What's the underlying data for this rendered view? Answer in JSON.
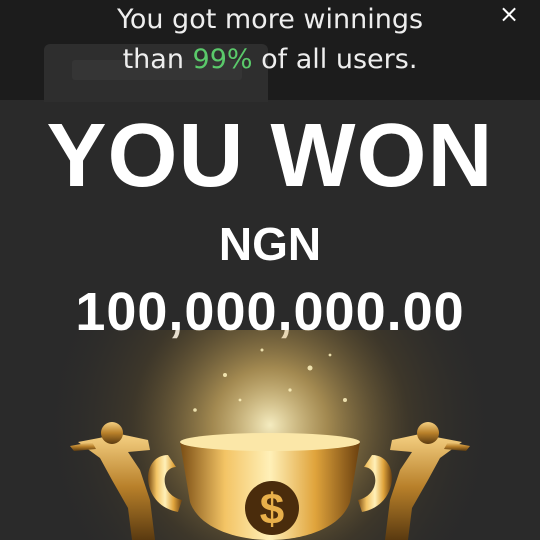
{
  "notice": {
    "line1": "You got more winnings",
    "line2_prefix": "than ",
    "line2_percent": "99%",
    "line2_suffix": " of all users."
  },
  "close_icon": "×",
  "headline": "YOU WON",
  "currency": "NGN",
  "amount": "100,000,000.00",
  "colors": {
    "background": "#2a2a2a",
    "top_band": "#1c1c1c",
    "percent_highlight": "#5ac96a",
    "gold": "#d9a43a"
  },
  "icons": {
    "close": "close-icon",
    "trophy": "trophy-icon",
    "dollar": "dollar-icon"
  }
}
